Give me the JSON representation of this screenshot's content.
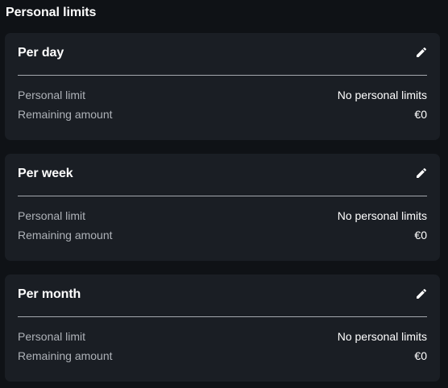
{
  "page": {
    "title": "Personal limits"
  },
  "cards": [
    {
      "title": "Per day",
      "rows": [
        {
          "label": "Personal limit",
          "value": "No personal limits"
        },
        {
          "label": "Remaining amount",
          "value": "€0"
        }
      ]
    },
    {
      "title": "Per week",
      "rows": [
        {
          "label": "Personal limit",
          "value": "No personal limits"
        },
        {
          "label": "Remaining amount",
          "value": "€0"
        }
      ]
    },
    {
      "title": "Per month",
      "rows": [
        {
          "label": "Personal limit",
          "value": "No personal limits"
        },
        {
          "label": "Remaining amount",
          "value": "€0"
        }
      ]
    }
  ],
  "icons": {
    "edit": "pencil-icon"
  },
  "colors": {
    "background": "#0f1216",
    "card": "#1a1e24",
    "divider": "#a4a8ae",
    "label": "#aeb2b8",
    "text": "#ffffff"
  }
}
